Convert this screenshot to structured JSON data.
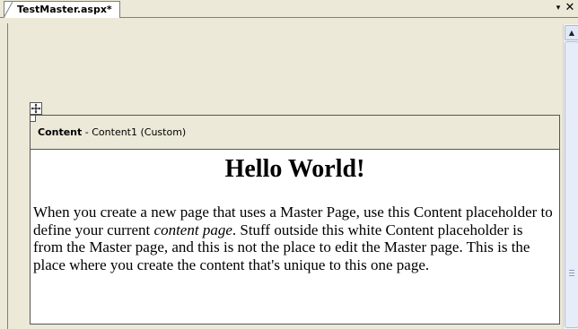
{
  "tab": {
    "title": "TestMaster.aspx*"
  },
  "controls": {
    "dropdown": "▾",
    "close": "✕"
  },
  "content_placeholder": {
    "label_bold": "Content",
    "label_rest": " - Content1 (Custom)"
  },
  "page": {
    "heading": "Hello World!",
    "para_part1": "When you create a new page that uses a Master Page, use this Content placeholder to define your current ",
    "para_italic": "content page",
    "para_part2": ". Stuff outside this white Content placeholder is from the Master page, and this is not the place to edit the Master page. This is the place where you create the content that's unique to this one page."
  },
  "icons": {
    "move": "move-handle-icon",
    "scroll_up": "chevron-up-icon",
    "dropdown": "chevron-down-icon",
    "close": "close-icon"
  },
  "colors": {
    "chrome": "#ece9d8",
    "page": "#ffffff",
    "border": "#555555"
  }
}
